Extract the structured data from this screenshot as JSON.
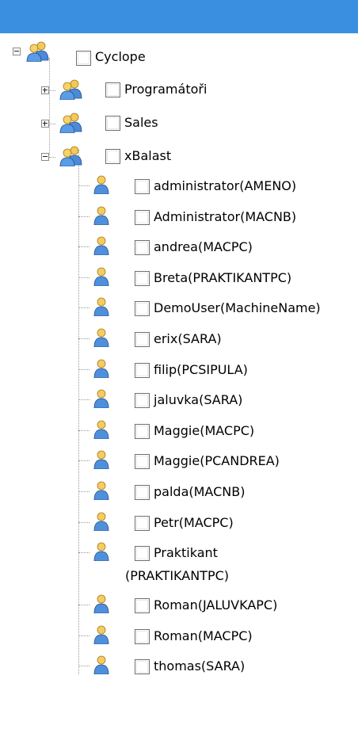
{
  "root": {
    "label": "Cyclope",
    "expanded": true,
    "checked": false
  },
  "groups": [
    {
      "label": "Programátoři",
      "expanded": false,
      "checked": false
    },
    {
      "label": "Sales",
      "expanded": false,
      "checked": false
    },
    {
      "label": "xBalast",
      "expanded": true,
      "checked": false
    }
  ],
  "users": [
    {
      "label": "administrator(AMENO)"
    },
    {
      "label": "Administrator(MACNB)"
    },
    {
      "label": "andrea(MACPC)"
    },
    {
      "label": "Breta(PRAKTIKANTPC)"
    },
    {
      "label": "DemoUser(MachineName)"
    },
    {
      "label": "erix(SARA)"
    },
    {
      "label": "filip(PCSIPULA)"
    },
    {
      "label": "jaluvka(SARA)"
    },
    {
      "label": "Maggie(MACPC)"
    },
    {
      "label": "Maggie(PCANDREA)"
    },
    {
      "label": "palda(MACNB)"
    },
    {
      "label": "Petr(MACPC)"
    },
    {
      "label": "Praktikant",
      "label_line2": "(PRAKTIKANTPC)"
    },
    {
      "label": "Roman(JALUVKAPC)"
    },
    {
      "label": "Roman(MACPC)"
    },
    {
      "label": "thomas(SARA)"
    }
  ],
  "icons": {
    "group": "user-group-icon",
    "user": "user-icon"
  }
}
